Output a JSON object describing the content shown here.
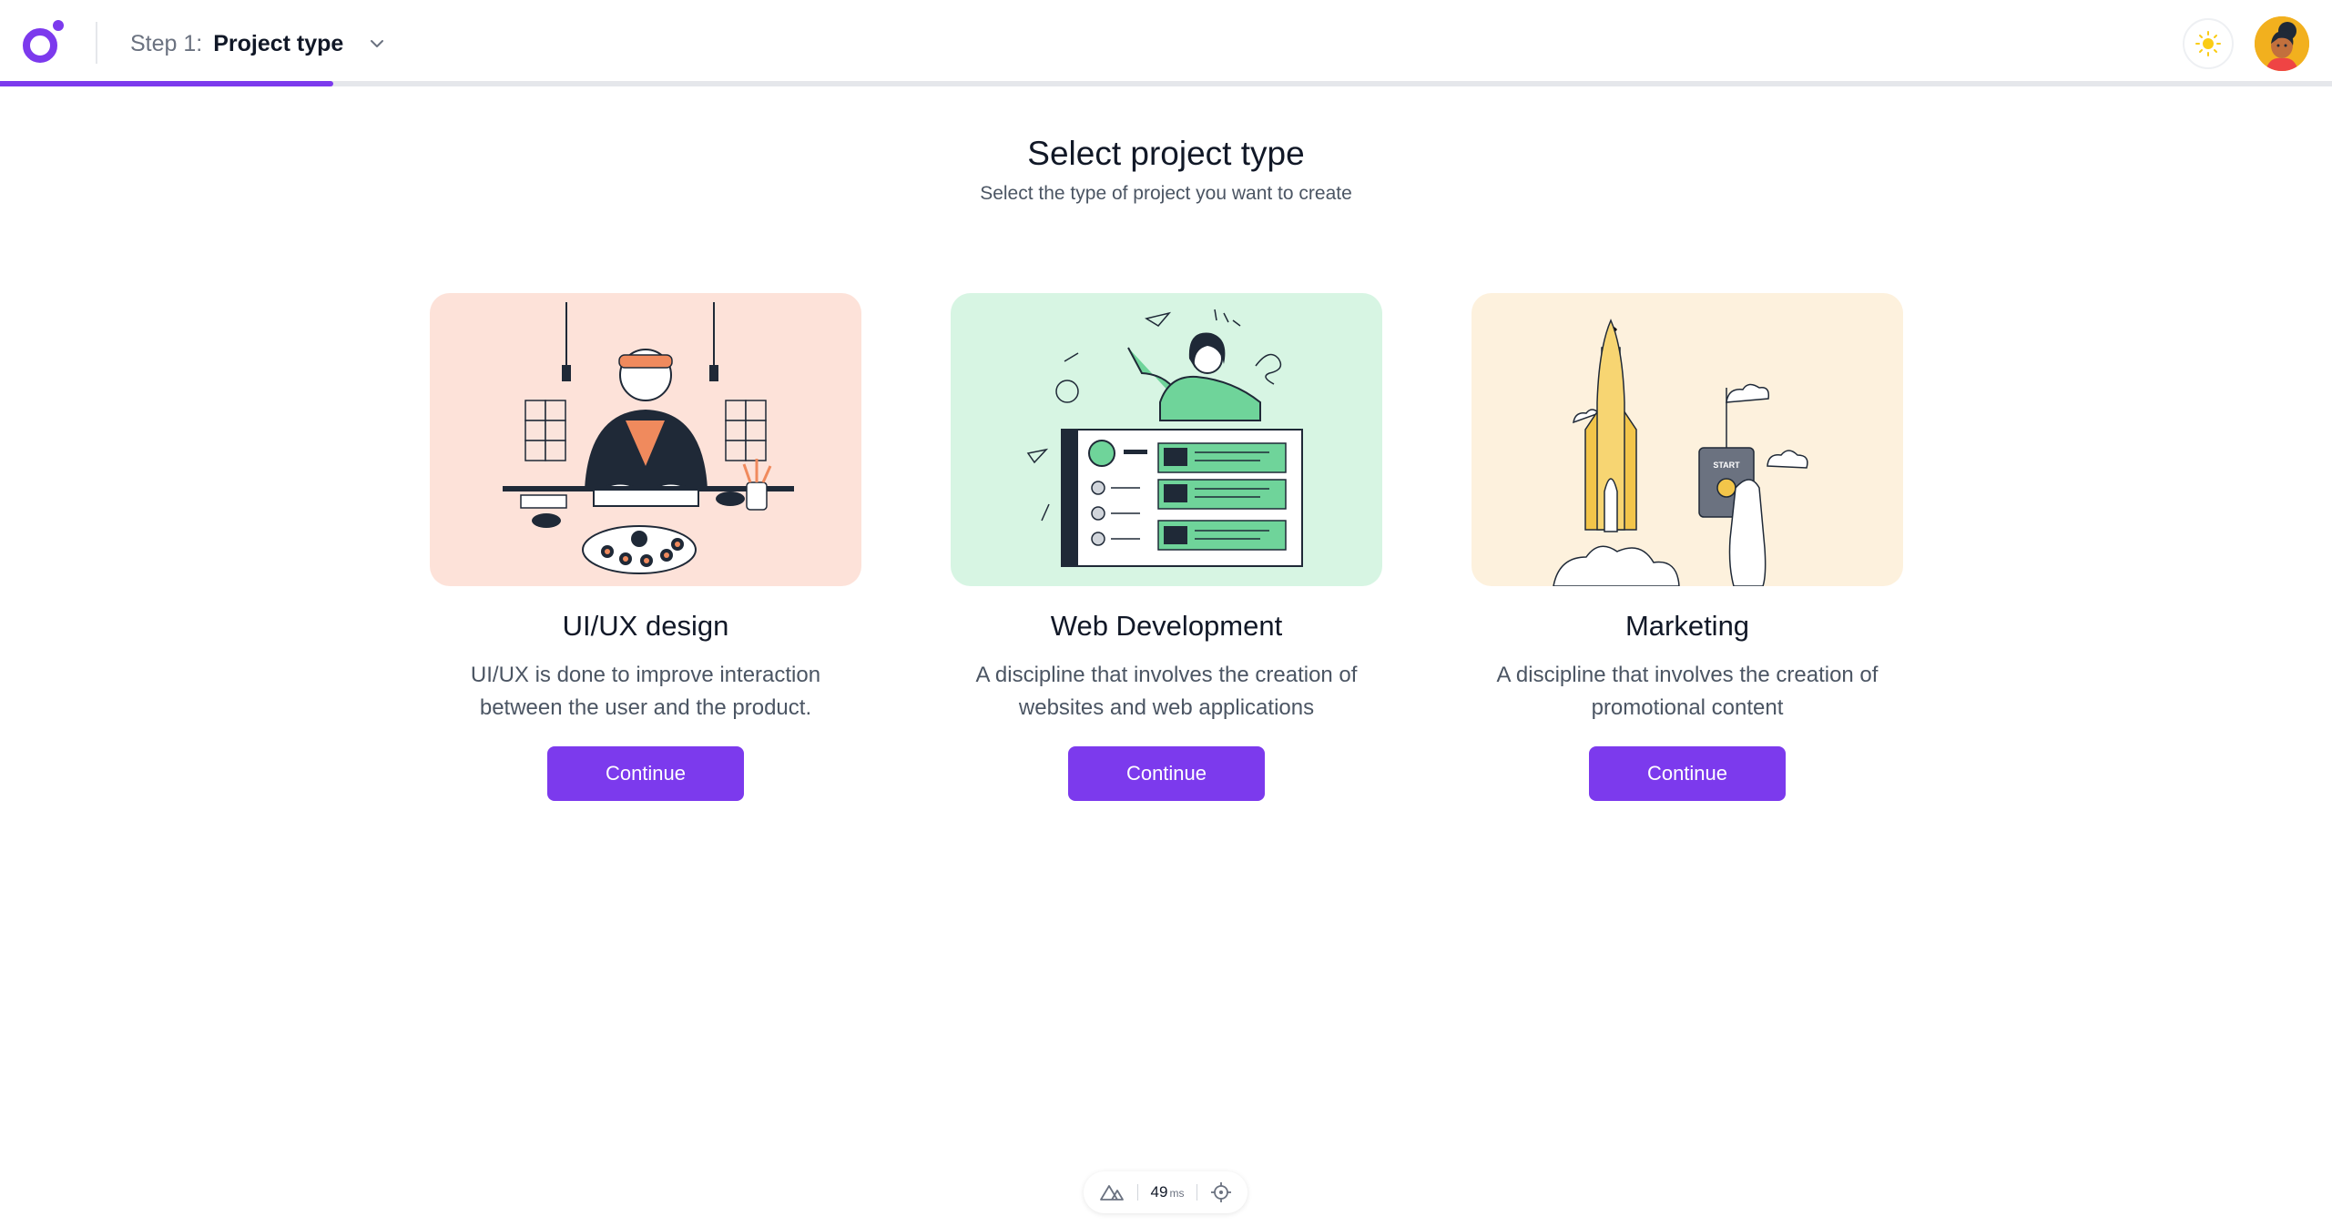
{
  "header": {
    "step_prefix": "Step 1:",
    "step_title": "Project type",
    "logo_icon": "app-logo",
    "chevron_icon": "chevron-down-icon",
    "theme_icon": "sun-icon",
    "avatar_icon": "user-avatar",
    "progress": 0.143,
    "accent_color": "#7c3aed"
  },
  "page": {
    "title": "Select project type",
    "subtitle": "Select the type of project you want to create"
  },
  "cards": [
    {
      "title": "UI/UX design",
      "description": "UI/UX is done to improve interaction between the user and the product.",
      "button": "Continue",
      "bg_color": "#fde2d9"
    },
    {
      "title": "Web Development",
      "description": "A discipline that involves the creation of websites and web applications",
      "button": "Continue",
      "bg_color": "#d7f5e3"
    },
    {
      "title": "Marketing",
      "description": "A discipline that involves the creation of promotional content",
      "button": "Continue",
      "bg_color": "#fdf1dd"
    }
  ],
  "perf": {
    "value": "49",
    "unit": "ms",
    "icon_left": "nuxt-icon",
    "icon_right": "crosshair-icon"
  }
}
